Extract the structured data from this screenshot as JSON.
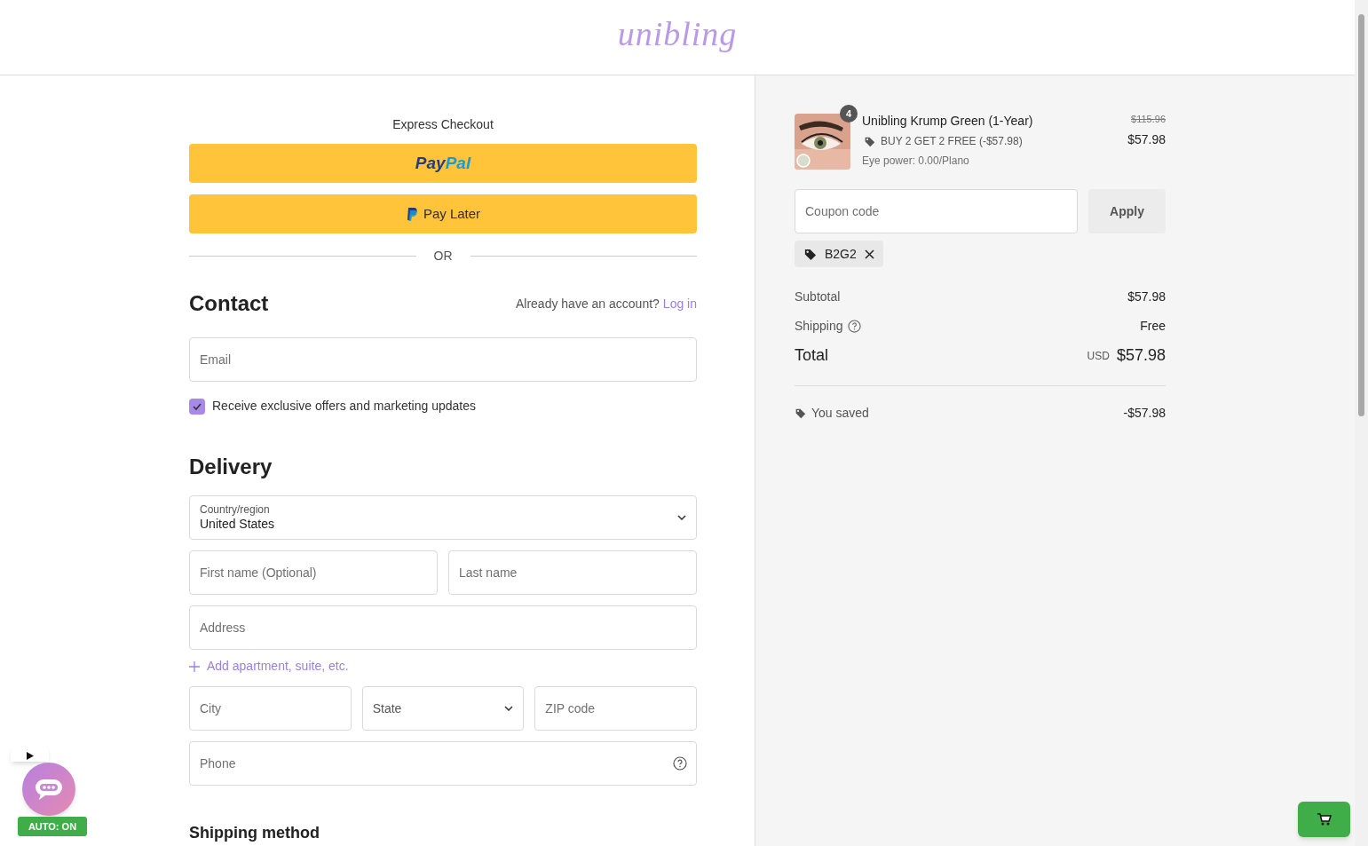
{
  "header": {
    "logo": "unibling"
  },
  "express": {
    "title": "Express Checkout",
    "buttons": [
      {
        "kind": "paypal",
        "label_a": "Pay",
        "label_b": "Pal"
      },
      {
        "kind": "paylater",
        "label": "Pay Later"
      }
    ],
    "divider": "OR"
  },
  "contact": {
    "title": "Contact",
    "account_prompt": "Already have an account?",
    "login_link": "Log in",
    "email": {
      "placeholder": "Email"
    },
    "marketing": {
      "label": "Receive exclusive offers and marketing updates",
      "checked": true
    }
  },
  "delivery": {
    "title": "Delivery",
    "country": {
      "label": "Country/region",
      "value": "United States"
    },
    "rows": [
      [
        {
          "kind": "text",
          "placeholder": "First name (Optional)"
        },
        {
          "kind": "text",
          "placeholder": "Last name"
        }
      ],
      [
        {
          "kind": "text",
          "placeholder": "Address"
        }
      ],
      [
        {
          "kind": "link",
          "label": "Add apartment, suite, etc."
        }
      ],
      [
        {
          "kind": "text",
          "placeholder": "City"
        },
        {
          "kind": "select",
          "placeholder": "State"
        },
        {
          "kind": "text",
          "placeholder": "ZIP code"
        }
      ],
      [
        {
          "kind": "help",
          "placeholder": "Phone"
        }
      ]
    ]
  },
  "shipping_method": {
    "title": "Shipping method"
  },
  "summary": {
    "items": [
      {
        "quantity": "4",
        "name": "Unibling Krump Green (1-Year)",
        "discount": "BUY 2 GET 2 FREE (-$57.98)",
        "variant": "Eye power: 0.00/Plano",
        "original_price": "$115.96",
        "price": "$57.98"
      }
    ],
    "coupon": {
      "placeholder": "Coupon code",
      "button": "Apply",
      "applied": [
        "B2G2"
      ]
    },
    "subtotal": {
      "label": "Subtotal",
      "value": "$57.98"
    },
    "shipping": {
      "label": "Shipping",
      "value": "Free"
    },
    "total": {
      "label": "Total",
      "currency": "USD",
      "value": "$57.98"
    },
    "saved": {
      "label": "You saved",
      "value": "-$57.98"
    }
  },
  "widgets": {
    "auto_badge": "AUTO: ON"
  }
}
